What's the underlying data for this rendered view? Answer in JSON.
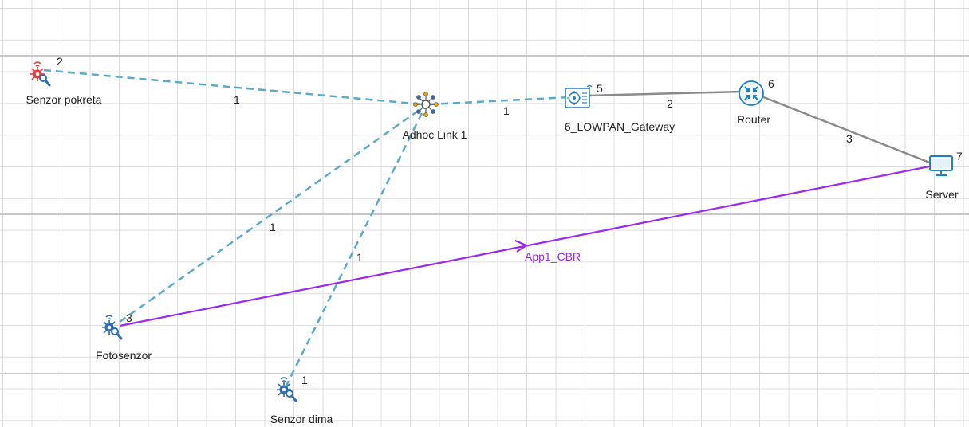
{
  "colors": {
    "wireless_link": "#5aa9c8",
    "wired_link": "#8a8a8a",
    "application_flow": "#9a28f2",
    "sensor_red": "#e03a3a",
    "sensor_blue": "#2f6db3",
    "device_blue": "#1f7fc4"
  },
  "nodes": {
    "senzor_pokreta": {
      "label": "Senzor pokreta",
      "id": "2",
      "icon": "motion-sensor-icon"
    },
    "fotosenzor": {
      "label": "Fotosenzor",
      "id": "3",
      "icon": "light-sensor-icon"
    },
    "senzor_dima": {
      "label": "Senzor dima",
      "id": "1",
      "icon": "smoke-sensor-icon"
    },
    "adhoc": {
      "label": "Adhoc Link 1",
      "icon": "adhoc-link-icon"
    },
    "gateway": {
      "label": "6_LOWPAN_Gateway",
      "id": "5",
      "icon": "gateway-icon"
    },
    "router": {
      "label": "Router",
      "id": "6",
      "icon": "router-icon"
    },
    "server": {
      "label": "Server",
      "id": "7",
      "icon": "monitor-icon"
    }
  },
  "links": {
    "pokreta_adhoc": "1",
    "adhoc_gateway": "1",
    "foto_adhoc": "1",
    "dima_adhoc": "1",
    "gateway_router": "2",
    "router_server": "3"
  },
  "application": {
    "name": "App1_CBR"
  }
}
